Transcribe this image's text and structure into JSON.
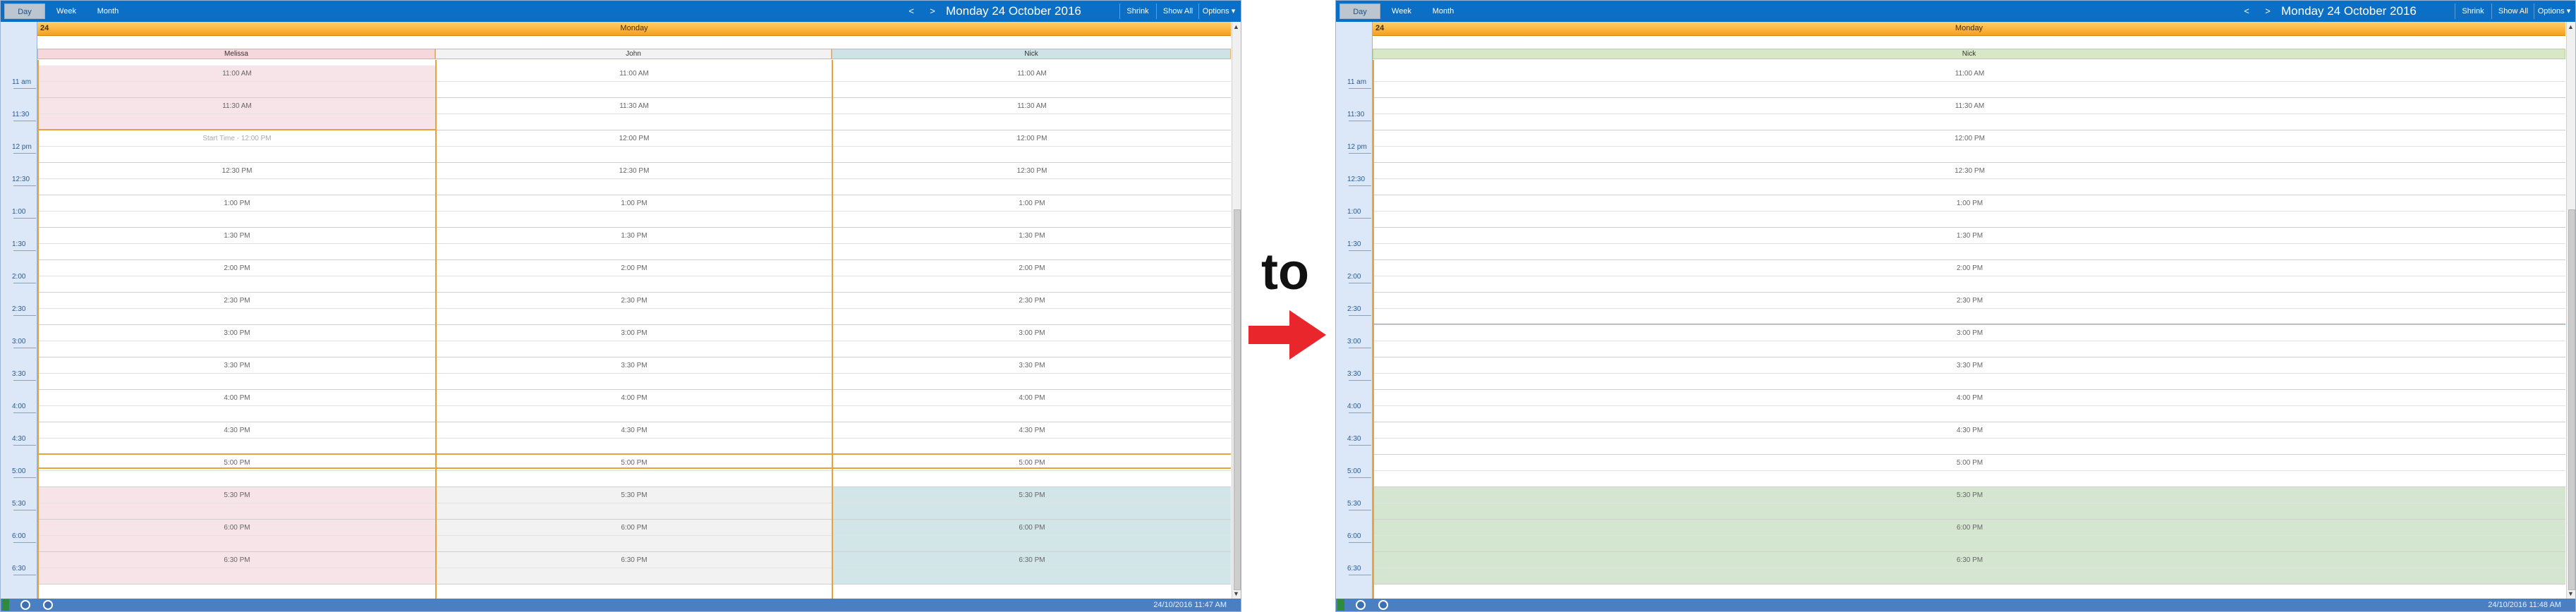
{
  "toolbar": {
    "day": "Day",
    "week": "Week",
    "month": "Month",
    "prev": "<",
    "next": ">",
    "date": "Monday 24 October 2016",
    "shrink": "Shrink",
    "show_all": "Show All",
    "options": "Options ▾"
  },
  "day_header": {
    "num": "24",
    "label": "Monday"
  },
  "left": {
    "resources": [
      "Melissa",
      "John",
      "Nick"
    ],
    "status_time": "24/10/2016 11:47 AM"
  },
  "right": {
    "resources": [
      "Nick"
    ],
    "status_time": "24/10/2016 11:48 AM"
  },
  "middle": {
    "to": "to"
  },
  "gutter": {
    "labels": [
      "11 am",
      "11:30",
      "12 pm",
      "12:30",
      "1:00",
      "1:30",
      "2:00",
      "2:30",
      "3:00",
      "3:30",
      "4:00",
      "4:30",
      "5:00",
      "5:30",
      "6:00",
      "6:30"
    ]
  },
  "slots": [
    "11:00 AM",
    "11:30 AM",
    "12:00 PM",
    "12:30 PM",
    "1:00 PM",
    "1:30 PM",
    "2:00 PM",
    "2:30 PM",
    "3:00 PM",
    "3:30 PM",
    "4:00 PM",
    "4:30 PM",
    "5:00 PM",
    "5:30 PM",
    "6:00 PM",
    "6:30 PM"
  ],
  "melissa_noon_slot": "Start Time - 12:00 PM",
  "colors": {
    "melissa": "#f7e4e8",
    "john_after": "#f2f2f2",
    "nick_after": "#d2e5e8",
    "right_after": "#d5e6d0",
    "right_header": "#d8e8c6",
    "accent": "#0b6fc6"
  },
  "icons": [
    "green-square-icon",
    "clock-icon",
    "user-icon",
    "red-arrow-icon"
  ]
}
